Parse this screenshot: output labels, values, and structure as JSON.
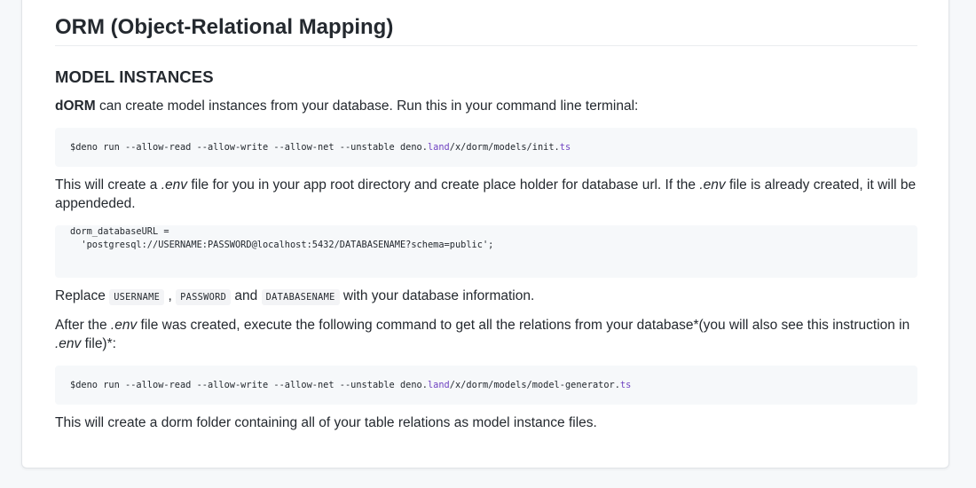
{
  "title": "ORM (Object-Relational Mapping)",
  "section": "MODEL INSTANCES",
  "intro": {
    "brand": "dORM",
    "text": " can create model instances from your database. Run this in your command line terminal:"
  },
  "code1": {
    "prefix": "$deno run --allow-read --allow-write --allow-net --unstable deno.",
    "hl1": "land",
    "mid": "/x/dorm/models/init.",
    "hl2": "ts"
  },
  "env_note": {
    "part1": "This will create a ",
    "env1": ".env",
    "part2": " file for you in your app root directory and create place holder for database url. If the ",
    "env2": ".env",
    "part3": " file is already created, it will be appendeded."
  },
  "code2": {
    "line1": "dorm_databaseURL =",
    "line2": "  'postgresql://USERNAME:PASSWORD@localhost:5432/DATABASENAME?schema=public';"
  },
  "replace": {
    "prefix": "Replace ",
    "code_user": "USERNAME",
    "sep1": " , ",
    "code_pass": "PASSWORD",
    "sep2": " and ",
    "code_db": "DATABASENAME",
    "suffix": " with your database information."
  },
  "after": {
    "part1": "After the ",
    "env1": ".env",
    "part2": " file was created, execute the following command to get all the relations from your database*(you will also see this instruction in ",
    "env2": ".env",
    "part3": " file)*:"
  },
  "code3": {
    "prefix": "$deno run --allow-read --allow-write --allow-net --unstable deno.",
    "hl1": "land",
    "mid": "/x/dorm/models/model-generator.",
    "hl2": "ts"
  },
  "final": "This will create a dorm folder containing all of your table relations as model instance files.",
  "colors": {
    "text": "#24292f",
    "code_bg": "#f6f8fa",
    "code_highlight": "#6f42c1",
    "border": "#e1e4e8"
  }
}
